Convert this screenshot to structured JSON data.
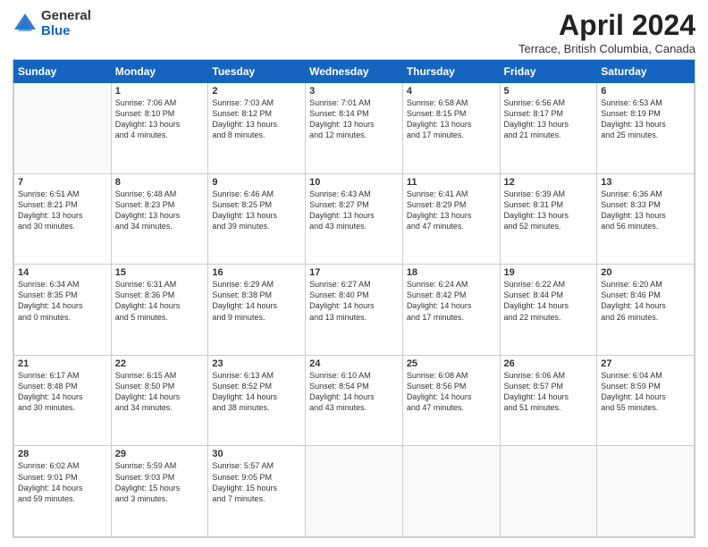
{
  "header": {
    "logo_general": "General",
    "logo_blue": "Blue",
    "title": "April 2024",
    "location": "Terrace, British Columbia, Canada"
  },
  "days_of_week": [
    "Sunday",
    "Monday",
    "Tuesday",
    "Wednesday",
    "Thursday",
    "Friday",
    "Saturday"
  ],
  "weeks": [
    [
      {
        "day": "",
        "info": ""
      },
      {
        "day": "1",
        "info": "Sunrise: 7:06 AM\nSunset: 8:10 PM\nDaylight: 13 hours\nand 4 minutes."
      },
      {
        "day": "2",
        "info": "Sunrise: 7:03 AM\nSunset: 8:12 PM\nDaylight: 13 hours\nand 8 minutes."
      },
      {
        "day": "3",
        "info": "Sunrise: 7:01 AM\nSunset: 8:14 PM\nDaylight: 13 hours\nand 12 minutes."
      },
      {
        "day": "4",
        "info": "Sunrise: 6:58 AM\nSunset: 8:15 PM\nDaylight: 13 hours\nand 17 minutes."
      },
      {
        "day": "5",
        "info": "Sunrise: 6:56 AM\nSunset: 8:17 PM\nDaylight: 13 hours\nand 21 minutes."
      },
      {
        "day": "6",
        "info": "Sunrise: 6:53 AM\nSunset: 8:19 PM\nDaylight: 13 hours\nand 25 minutes."
      }
    ],
    [
      {
        "day": "7",
        "info": "Sunrise: 6:51 AM\nSunset: 8:21 PM\nDaylight: 13 hours\nand 30 minutes."
      },
      {
        "day": "8",
        "info": "Sunrise: 6:48 AM\nSunset: 8:23 PM\nDaylight: 13 hours\nand 34 minutes."
      },
      {
        "day": "9",
        "info": "Sunrise: 6:46 AM\nSunset: 8:25 PM\nDaylight: 13 hours\nand 39 minutes."
      },
      {
        "day": "10",
        "info": "Sunrise: 6:43 AM\nSunset: 8:27 PM\nDaylight: 13 hours\nand 43 minutes."
      },
      {
        "day": "11",
        "info": "Sunrise: 6:41 AM\nSunset: 8:29 PM\nDaylight: 13 hours\nand 47 minutes."
      },
      {
        "day": "12",
        "info": "Sunrise: 6:39 AM\nSunset: 8:31 PM\nDaylight: 13 hours\nand 52 minutes."
      },
      {
        "day": "13",
        "info": "Sunrise: 6:36 AM\nSunset: 8:33 PM\nDaylight: 13 hours\nand 56 minutes."
      }
    ],
    [
      {
        "day": "14",
        "info": "Sunrise: 6:34 AM\nSunset: 8:35 PM\nDaylight: 14 hours\nand 0 minutes."
      },
      {
        "day": "15",
        "info": "Sunrise: 6:31 AM\nSunset: 8:36 PM\nDaylight: 14 hours\nand 5 minutes."
      },
      {
        "day": "16",
        "info": "Sunrise: 6:29 AM\nSunset: 8:38 PM\nDaylight: 14 hours\nand 9 minutes."
      },
      {
        "day": "17",
        "info": "Sunrise: 6:27 AM\nSunset: 8:40 PM\nDaylight: 14 hours\nand 13 minutes."
      },
      {
        "day": "18",
        "info": "Sunrise: 6:24 AM\nSunset: 8:42 PM\nDaylight: 14 hours\nand 17 minutes."
      },
      {
        "day": "19",
        "info": "Sunrise: 6:22 AM\nSunset: 8:44 PM\nDaylight: 14 hours\nand 22 minutes."
      },
      {
        "day": "20",
        "info": "Sunrise: 6:20 AM\nSunset: 8:46 PM\nDaylight: 14 hours\nand 26 minutes."
      }
    ],
    [
      {
        "day": "21",
        "info": "Sunrise: 6:17 AM\nSunset: 8:48 PM\nDaylight: 14 hours\nand 30 minutes."
      },
      {
        "day": "22",
        "info": "Sunrise: 6:15 AM\nSunset: 8:50 PM\nDaylight: 14 hours\nand 34 minutes."
      },
      {
        "day": "23",
        "info": "Sunrise: 6:13 AM\nSunset: 8:52 PM\nDaylight: 14 hours\nand 38 minutes."
      },
      {
        "day": "24",
        "info": "Sunrise: 6:10 AM\nSunset: 8:54 PM\nDaylight: 14 hours\nand 43 minutes."
      },
      {
        "day": "25",
        "info": "Sunrise: 6:08 AM\nSunset: 8:56 PM\nDaylight: 14 hours\nand 47 minutes."
      },
      {
        "day": "26",
        "info": "Sunrise: 6:06 AM\nSunset: 8:57 PM\nDaylight: 14 hours\nand 51 minutes."
      },
      {
        "day": "27",
        "info": "Sunrise: 6:04 AM\nSunset: 8:59 PM\nDaylight: 14 hours\nand 55 minutes."
      }
    ],
    [
      {
        "day": "28",
        "info": "Sunrise: 6:02 AM\nSunset: 9:01 PM\nDaylight: 14 hours\nand 59 minutes."
      },
      {
        "day": "29",
        "info": "Sunrise: 5:59 AM\nSunset: 9:03 PM\nDaylight: 15 hours\nand 3 minutes."
      },
      {
        "day": "30",
        "info": "Sunrise: 5:57 AM\nSunset: 9:05 PM\nDaylight: 15 hours\nand 7 minutes."
      },
      {
        "day": "",
        "info": ""
      },
      {
        "day": "",
        "info": ""
      },
      {
        "day": "",
        "info": ""
      },
      {
        "day": "",
        "info": ""
      }
    ]
  ]
}
